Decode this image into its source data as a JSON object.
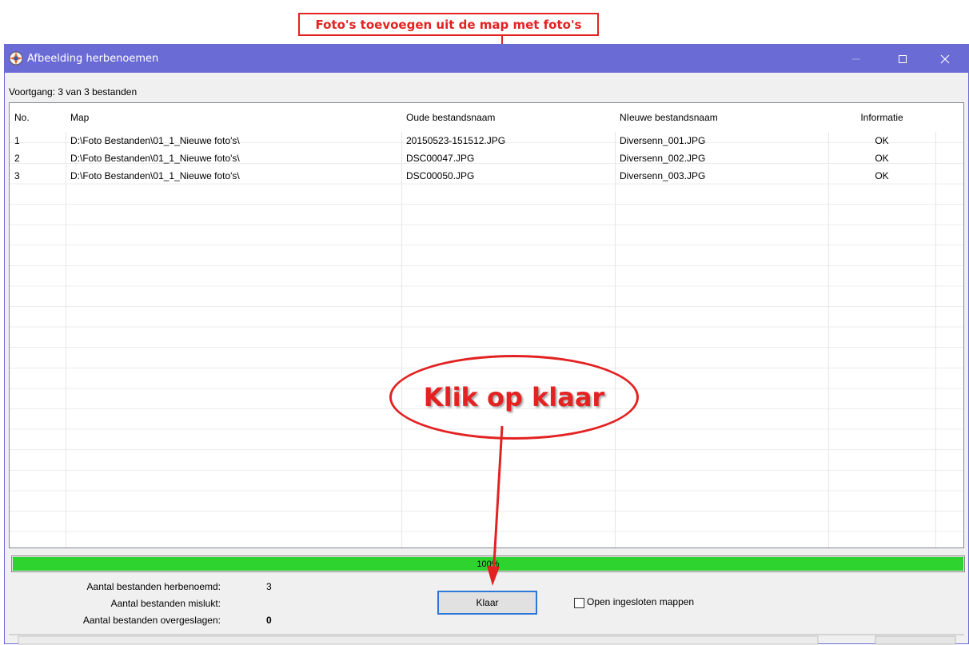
{
  "annotations": {
    "top_callout": "Foto's toevoegen uit de map met foto's",
    "ellipse_text": "Klik op  klaar"
  },
  "window": {
    "title": "Afbeelding herbenoemen",
    "buttons": {
      "minimize": "—",
      "maximize": "☐",
      "close": "✕"
    }
  },
  "progress_text": "Voortgang: 3 van 3 bestanden",
  "table": {
    "columns": [
      "No.",
      "Map",
      "Oude bestandsnaam",
      "NIeuwe bestandsnaam",
      "Informatie"
    ],
    "rows": [
      [
        "1",
        "D:\\Foto Bestanden\\01_1_Nieuwe foto's\\",
        "20150523-151512.JPG",
        "Diversenn_001.JPG",
        "OK"
      ],
      [
        "2",
        "D:\\Foto Bestanden\\01_1_Nieuwe foto's\\",
        "DSC00047.JPG",
        "Diversenn_002.JPG",
        "OK"
      ],
      [
        "3",
        "D:\\Foto Bestanden\\01_1_Nieuwe foto's\\",
        "DSC00050.JPG",
        "Diversenn_003.JPG",
        "OK"
      ]
    ]
  },
  "progress_bar": {
    "percent_label": "100%",
    "fraction": 1.0
  },
  "stats": [
    {
      "label": "Aantal bestanden herbenoemd:",
      "value": "3"
    },
    {
      "label": "Aantal bestanden mislukt:",
      "value": ""
    },
    {
      "label": "Aantal bestanden overgeslagen:",
      "value": "0"
    }
  ],
  "buttons": {
    "klaar": "Klaar"
  },
  "checkbox": {
    "label": "Open ingesloten mappen",
    "checked": false
  },
  "colors": {
    "titlebar": "#6b6bd6",
    "annotation_red": "#e32222",
    "progress_green": "#2fd32f",
    "button_focus": "#2c78d8"
  },
  "icons": {
    "app": "app-icon",
    "minimize": "minimize-icon",
    "maximize": "maximize-icon",
    "close": "close-icon"
  }
}
